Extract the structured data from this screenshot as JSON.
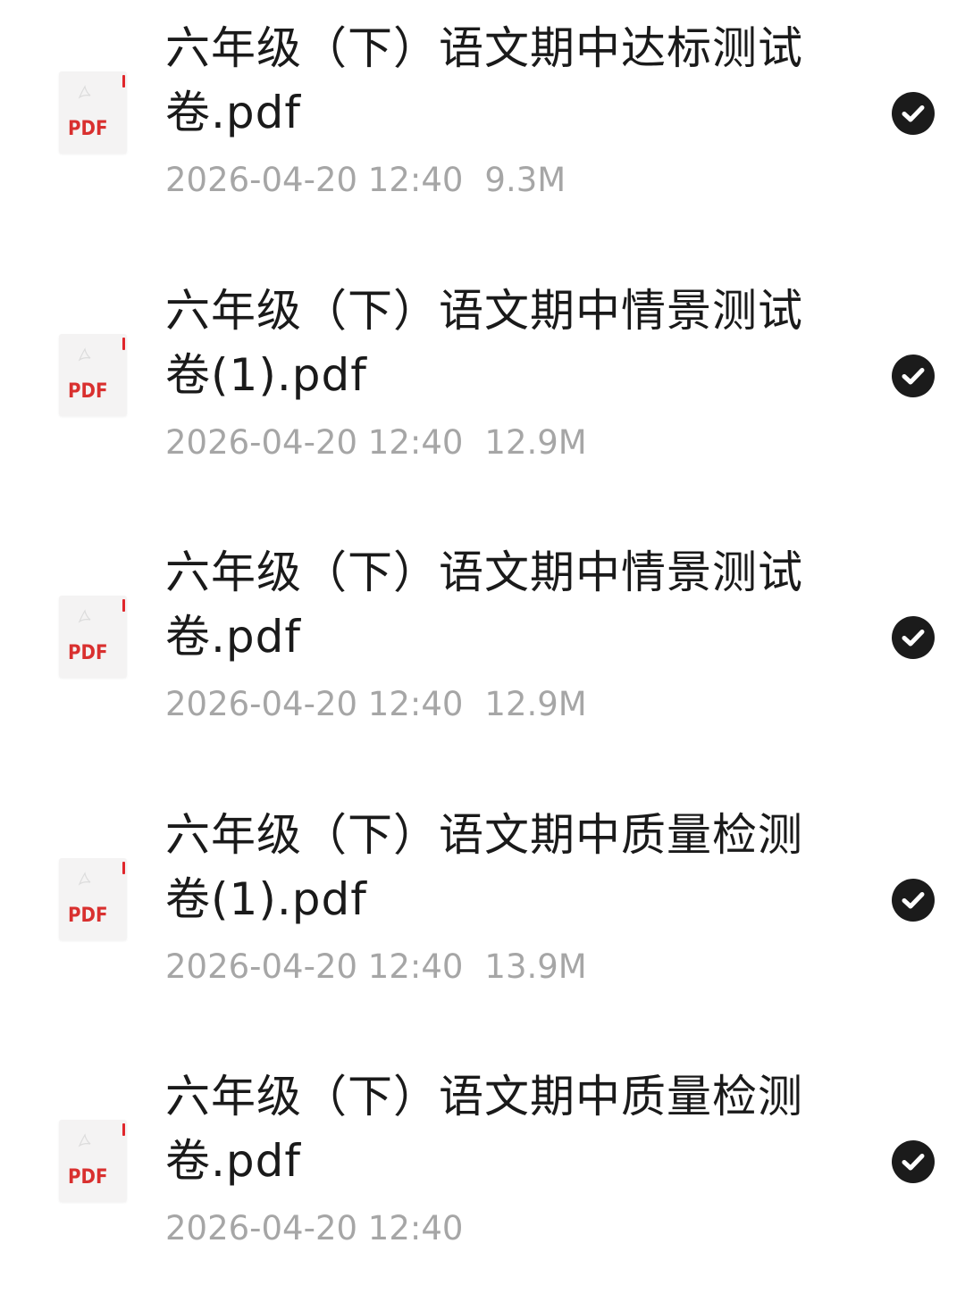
{
  "files": [
    {
      "name": "六年级（下）语文期中达标测试卷.pdf",
      "date": "2026-04-20 12:40",
      "size": "9.3M",
      "type_label": "PDF",
      "selected": true
    },
    {
      "name": "六年级（下）语文期中情景测试卷(1).pdf",
      "date": "2026-04-20 12:40",
      "size": "12.9M",
      "type_label": "PDF",
      "selected": true
    },
    {
      "name": "六年级（下）语文期中情景测试卷.pdf",
      "date": "2026-04-20 12:40",
      "size": "12.9M",
      "type_label": "PDF",
      "selected": true
    },
    {
      "name": "六年级（下）语文期中质量检测卷(1).pdf",
      "date": "2026-04-20 12:40",
      "size": "13.9M",
      "type_label": "PDF",
      "selected": true
    },
    {
      "name": "六年级（下）语文期中质量检测卷.pdf",
      "date": "2026-04-20 12:40",
      "size": "",
      "type_label": "PDF",
      "selected": true
    }
  ],
  "icons": {
    "file": "pdf-file-icon",
    "selected": "checkmark-circle-icon"
  },
  "colors": {
    "pdf_red": "#d9302f",
    "check_fill": "#1b1b1b",
    "meta_gray": "#a6a6a6",
    "name_text": "#1a1a1a"
  }
}
